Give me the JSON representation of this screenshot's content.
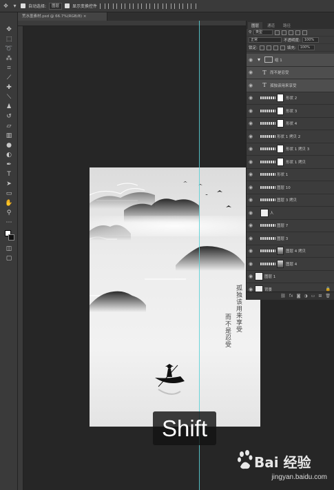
{
  "options_bar": {
    "auto_select_label": "自动选择:",
    "auto_select_value": "图层",
    "show_transform_label": "显示变换控件"
  },
  "document_tab": {
    "title": "荒水墨素材.psd @ 66.7%(RGB/8) ×"
  },
  "layers_panel": {
    "tabs": [
      "图层",
      "通道",
      "路径"
    ],
    "filter_kind": "类型",
    "blend_mode": "正常",
    "opacity_label": "不透明度:",
    "opacity_value": "100%",
    "lock_label": "锁定:",
    "fill_label": "填充:",
    "fill_value": "100%",
    "layers": [
      {
        "name": "组 1",
        "kind": "group",
        "selected": true
      },
      {
        "name": "而不是忍受",
        "kind": "text",
        "selected": true
      },
      {
        "name": "孤独该用来享受",
        "kind": "text",
        "selected": true
      },
      {
        "name": "形状 2",
        "kind": "shape-mask",
        "selected": false
      },
      {
        "name": "形状 3",
        "kind": "shape-mask",
        "selected": false
      },
      {
        "name": "形状 4",
        "kind": "shape-mask",
        "selected": false
      },
      {
        "name": "形状 1 拷贝 2",
        "kind": "shape",
        "selected": false
      },
      {
        "name": "形状 1 拷贝 3",
        "kind": "shape-mask",
        "selected": false
      },
      {
        "name": "形状 1 拷贝",
        "kind": "shape-mask",
        "selected": false
      },
      {
        "name": "形状 1",
        "kind": "shape",
        "selected": false
      },
      {
        "name": "图层 10",
        "kind": "shape",
        "selected": false
      },
      {
        "name": "图层 3 拷贝",
        "kind": "shape",
        "selected": false
      },
      {
        "name": "人",
        "kind": "image",
        "selected": false
      },
      {
        "name": "图层 7",
        "kind": "shape",
        "selected": false
      },
      {
        "name": "图层 3",
        "kind": "shape",
        "selected": false
      },
      {
        "name": "图层 4 拷贝",
        "kind": "shape-mask-dark",
        "selected": false
      },
      {
        "name": "图层 4",
        "kind": "shape-mask-dark",
        "selected": false
      },
      {
        "name": "图层 1",
        "kind": "plain",
        "selected": false
      },
      {
        "name": "背景",
        "kind": "background",
        "selected": false
      }
    ]
  },
  "canvas": {
    "poem_right": "孤独该用来享受",
    "poem_left": "而不是忍受"
  },
  "overlay": {
    "key_label": "Shift"
  },
  "watermark": {
    "text": "Bai 经验",
    "url": "jingyan.baidu.com"
  },
  "colors": {
    "guide": "#5ad0d6",
    "panel_bg": "#3c3c3c",
    "workspace": "#262626"
  }
}
